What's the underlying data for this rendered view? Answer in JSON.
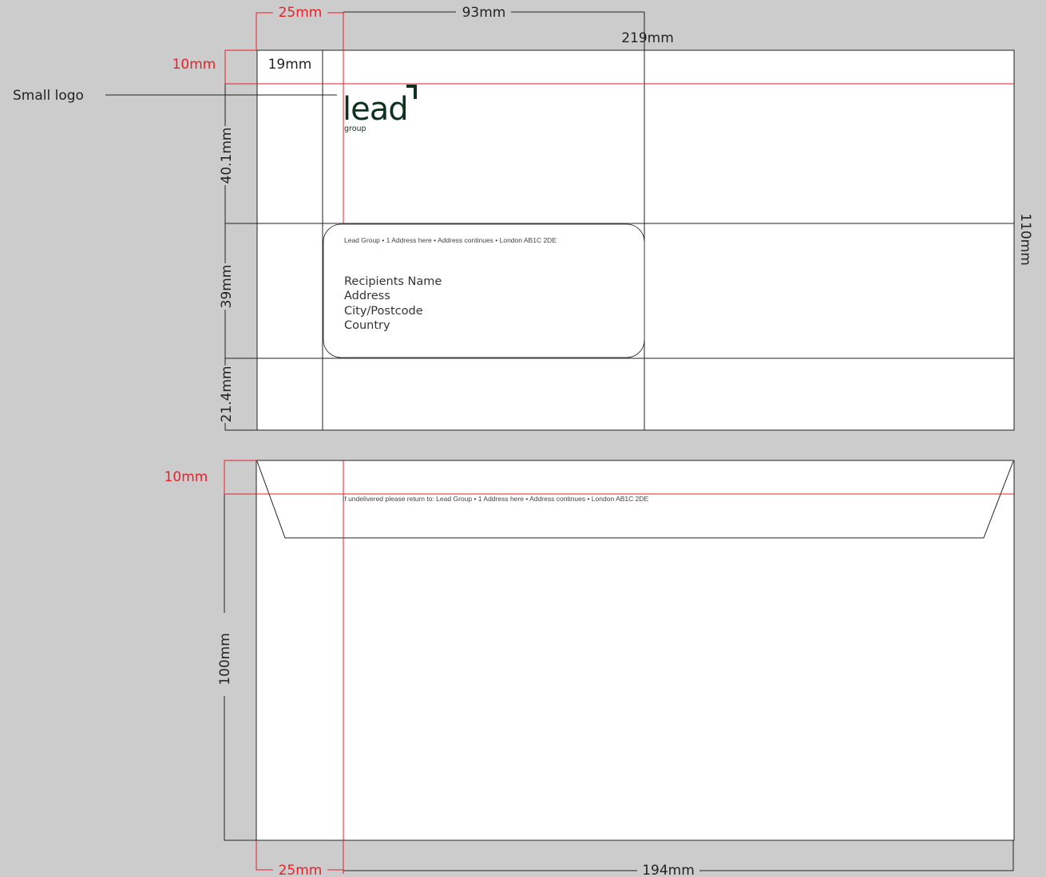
{
  "colors": {
    "background": "#cccccc",
    "paper": "#ffffff",
    "line": "#222222",
    "guide_red": "#e8202a",
    "logo_green": "#0d3320"
  },
  "front": {
    "dim_top_margin_offset": "25mm",
    "dim_window_width": "93mm",
    "dim_total_width": "219mm",
    "dim_top_margin": "10mm",
    "dim_left_column": "19mm",
    "dim_logo_zone": "40.1mm",
    "dim_window_height": "39mm",
    "dim_bottom_zone": "21.4mm",
    "dim_total_height": "110mm",
    "callout_small_logo": "Small logo",
    "logo_word": "lead",
    "logo_sub": "group",
    "return_address": "Lead Group • 1 Address here • Address continues • London AB1C 2DE",
    "recipient_lines": [
      "Recipients Name",
      "Address",
      "City/Postcode",
      "Country"
    ]
  },
  "back": {
    "dim_top_margin": "10mm",
    "dim_height": "100mm",
    "dim_left_offset": "25mm",
    "dim_width": "194mm",
    "return_line": "If undelivered please return to:  Lead Group • 1 Address here • Address continues • London AB1C 2DE"
  }
}
